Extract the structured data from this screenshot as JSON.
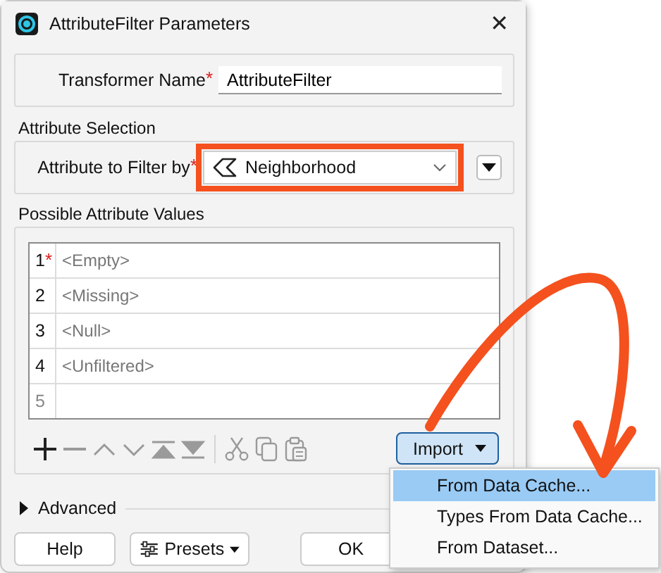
{
  "window": {
    "title": "AttributeFilter Parameters",
    "close": "✕"
  },
  "transformer_name": {
    "label": "Transformer Name",
    "required_mark": "*",
    "value": "AttributeFilter"
  },
  "attribute_selection": {
    "title": "Attribute Selection",
    "label": "Attribute to Filter by",
    "required_mark": "*",
    "value": "Neighborhood",
    "highlighted": true
  },
  "possible_values": {
    "title": "Possible Attribute Values",
    "rows": [
      {
        "kind": "entry",
        "number": "1",
        "required_mark": "*",
        "value": "<Empty>"
      },
      {
        "kind": "entry",
        "number": "2",
        "value": "<Missing>"
      },
      {
        "kind": "entry",
        "number": "3",
        "value": "<Null>"
      },
      {
        "kind": "entry",
        "number": "4",
        "value": "<Unfiltered>"
      },
      {
        "kind": "new",
        "number": "5"
      }
    ],
    "tools": [
      {
        "kind": "add",
        "disabled": false
      },
      {
        "kind": "remove",
        "disabled": true
      },
      {
        "kind": "up",
        "disabled": true
      },
      {
        "kind": "down",
        "disabled": true
      },
      {
        "kind": "top",
        "disabled": true
      },
      {
        "kind": "bottom",
        "disabled": true
      },
      {
        "kind": "cut",
        "disabled": true
      },
      {
        "kind": "copy",
        "disabled": true
      },
      {
        "kind": "paste",
        "disabled": true
      }
    ],
    "import": {
      "label": "Import",
      "open": true,
      "menu": [
        {
          "label": "From Data Cache...",
          "selected": true
        },
        {
          "label": "Types From Data Cache...",
          "selected": false
        },
        {
          "label": "From Dataset...",
          "selected": false
        }
      ]
    }
  },
  "advanced": {
    "label": "Advanced",
    "expanded": false
  },
  "footer": [
    {
      "kind": "help",
      "label": "Help"
    },
    {
      "kind": "presets",
      "label": "Presets"
    },
    {
      "kind": "ok",
      "label": "OK"
    }
  ]
}
